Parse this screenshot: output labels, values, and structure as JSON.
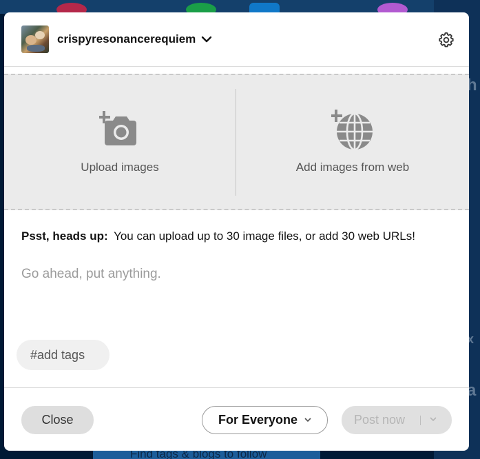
{
  "background": {
    "bottom_text": "Find tags & blogs to follow",
    "side_letters": [
      "h",
      "x",
      "a"
    ]
  },
  "header": {
    "blog_name": "crispyresonancerequiem",
    "avatar_icon": "blog-avatar",
    "dropdown_icon": "chevron-down-icon",
    "settings_icon": "gear-icon"
  },
  "upload": {
    "upload_images_label": "Upload images",
    "add_from_web_label": "Add images from web"
  },
  "notice": {
    "prefix": "Psst, heads up:",
    "text": "You can upload up to 30 image files, or add 30 web URLs!"
  },
  "body": {
    "placeholder": "Go ahead, put anything."
  },
  "tags": {
    "placeholder": "#add tags"
  },
  "footer": {
    "close_label": "Close",
    "audience_label": "For Everyone",
    "post_label": "Post now"
  },
  "colors": {
    "backdrop": "#001935",
    "upload_zone": "#ebebeb",
    "button_grey": "#dedede"
  }
}
